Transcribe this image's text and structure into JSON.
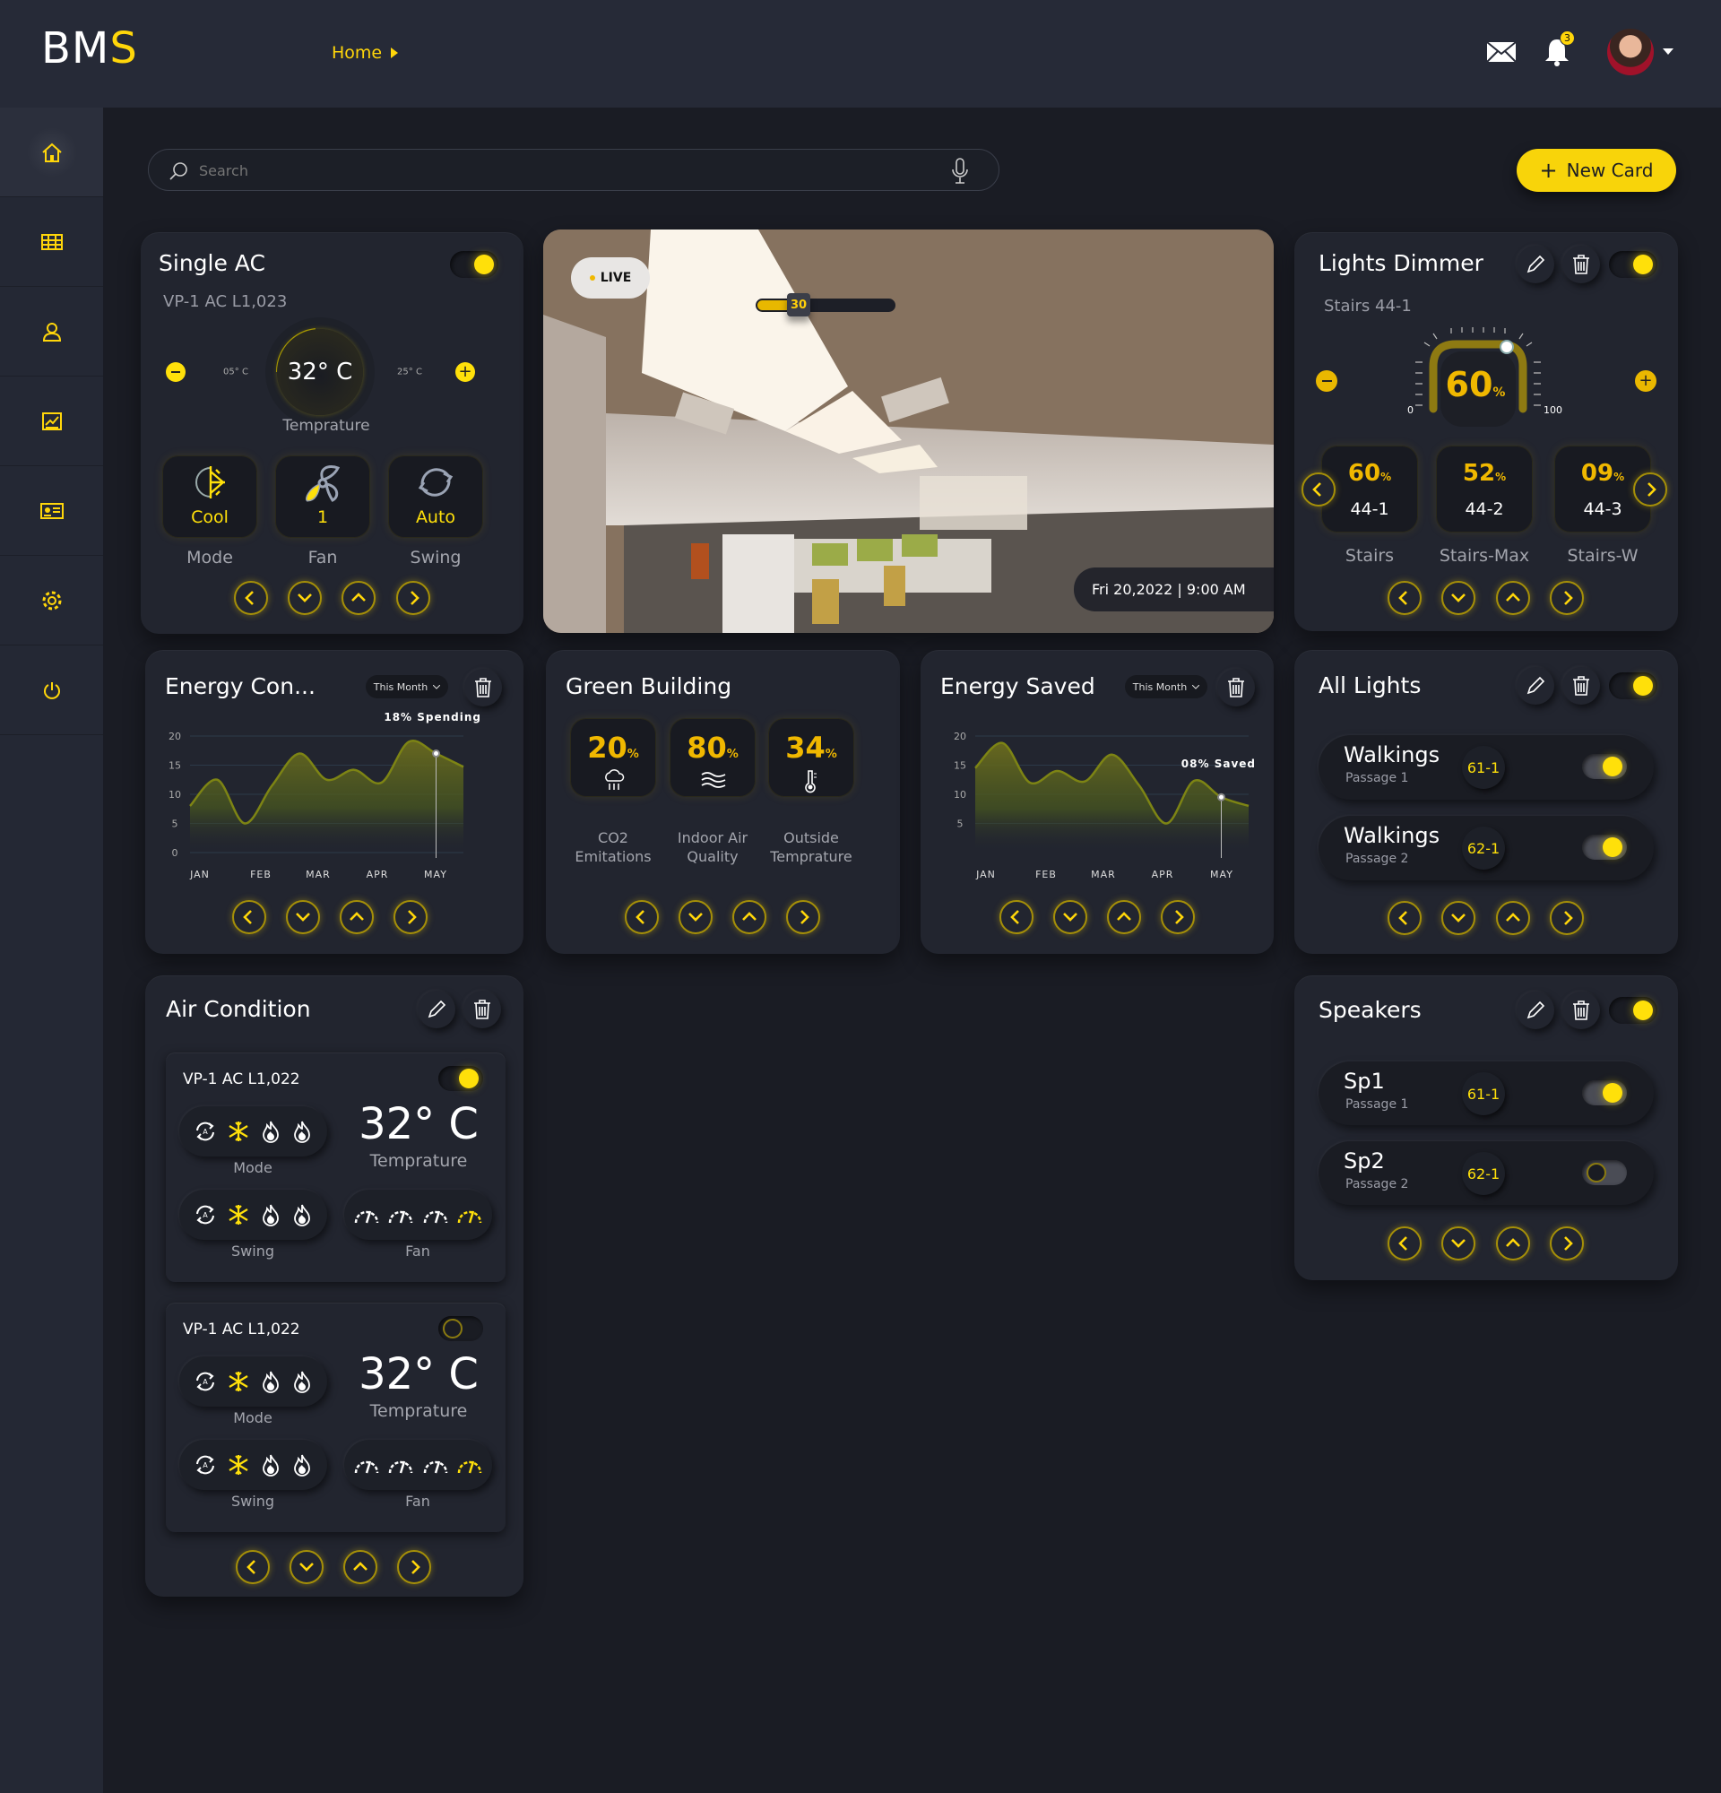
{
  "header": {
    "logo_main": "BM",
    "logo_accent": "S",
    "breadcrumb": "Home",
    "notification_count": "3"
  },
  "sidebar": {
    "items": [
      "home",
      "dashboard",
      "users",
      "reports",
      "devices",
      "settings",
      "power"
    ]
  },
  "search": {
    "placeholder": "Search"
  },
  "new_card_label": "New Card",
  "colors": {
    "accent": "#ffe00a",
    "amber": "#f0b800",
    "card_bg": "#22252f",
    "page_bg": "#1a1c24"
  },
  "single_ac": {
    "title": "Single AC",
    "device": "VP-1 AC L1,023",
    "power_on": true,
    "temperature": "32° C",
    "temperature_label": "Temprature",
    "min": "05° C",
    "max": "25° C",
    "tiles": [
      {
        "value": "Cool",
        "label": "Mode"
      },
      {
        "value": "1",
        "label": "Fan"
      },
      {
        "value": "Auto",
        "label": "Swing"
      }
    ]
  },
  "camera": {
    "live_label": "LIVE",
    "slider_value": "30",
    "slider_percent": 30,
    "timestamp": "Fri 20,2022 | 9:00 AM"
  },
  "lights_dimmer": {
    "title": "Lights Dimmer",
    "subtitle": "Stairs 44-1",
    "power_on": true,
    "dial_value": "60",
    "dial_unit": "%",
    "dial_min": "0",
    "dial_max": "100",
    "zones": [
      {
        "value": "60",
        "id": "44-1",
        "label": "Stairs"
      },
      {
        "value": "52",
        "id": "44-2",
        "label": "Stairs-Max"
      },
      {
        "value": "09",
        "id": "44-3",
        "label": "Stairs-W"
      }
    ]
  },
  "energy_con": {
    "title": "Energy Con...",
    "period": "This Month",
    "annotation": "18% Spending"
  },
  "green_building": {
    "title": "Green Building",
    "metrics": [
      {
        "value": "20",
        "label1": "CO2",
        "label2": "Emitations"
      },
      {
        "value": "80",
        "label1": "Indoor Air",
        "label2": "Quality"
      },
      {
        "value": "34",
        "label1": "Outside",
        "label2": "Temprature"
      }
    ]
  },
  "energy_saved": {
    "title": "Energy Saved",
    "period": "This Month",
    "annotation": "08% Saved"
  },
  "all_lights": {
    "title": "All Lights",
    "power_on": true,
    "rows": [
      {
        "name": "Walkings",
        "place": "Passage 1",
        "code": "61-1",
        "on": true
      },
      {
        "name": "Walkings",
        "place": "Passage 2",
        "code": "62-1",
        "on": true
      }
    ]
  },
  "speakers": {
    "title": "Speakers",
    "power_on": true,
    "rows": [
      {
        "name": "Sp1",
        "place": "Passage 1",
        "code": "61-1",
        "on": true
      },
      {
        "name": "Sp2",
        "place": "Passage 2",
        "code": "62-1",
        "on": false
      }
    ]
  },
  "air_condition": {
    "title": "Air Condition",
    "units": [
      {
        "name": "VP-1 AC L1,022",
        "on": true,
        "temperature": "32° C",
        "temperature_label": "Temprature",
        "mode_label": "Mode",
        "swing_label": "Swing",
        "fan_label": "Fan"
      },
      {
        "name": "VP-1 AC L1,022",
        "on": false,
        "temperature": "32° C",
        "temperature_label": "Temprature",
        "mode_label": "Mode",
        "swing_label": "Swing",
        "fan_label": "Fan"
      }
    ]
  },
  "chart_data": [
    {
      "type": "area",
      "title": "Energy Con...",
      "categories": [
        "JAN",
        "FEB",
        "MAR",
        "APR",
        "MAY"
      ],
      "y_ticks": [
        "0",
        "5",
        "10",
        "15",
        "20"
      ],
      "ylim": [
        0,
        20
      ],
      "series": [
        {
          "name": "Energy consumption",
          "values": [
            8,
            12.5,
            5,
            11.5,
            17,
            12.5,
            14.2,
            12,
            19,
            17,
            14.7
          ]
        }
      ],
      "marker_index": 9,
      "annotation": "18% Spending"
    },
    {
      "type": "area",
      "title": "Energy Saved",
      "categories": [
        "JAN",
        "FEB",
        "MAR",
        "APR",
        "MAY"
      ],
      "y_ticks": [
        "5",
        "10",
        "15",
        "20"
      ],
      "ylim": [
        0,
        20
      ],
      "series": [
        {
          "name": "Energy saved",
          "values": [
            14.5,
            18.8,
            12,
            14,
            12.2,
            16.8,
            11.5,
            5,
            12.3,
            9.5,
            8
          ]
        }
      ],
      "marker_index": 9,
      "annotation": "08% Saved"
    }
  ]
}
